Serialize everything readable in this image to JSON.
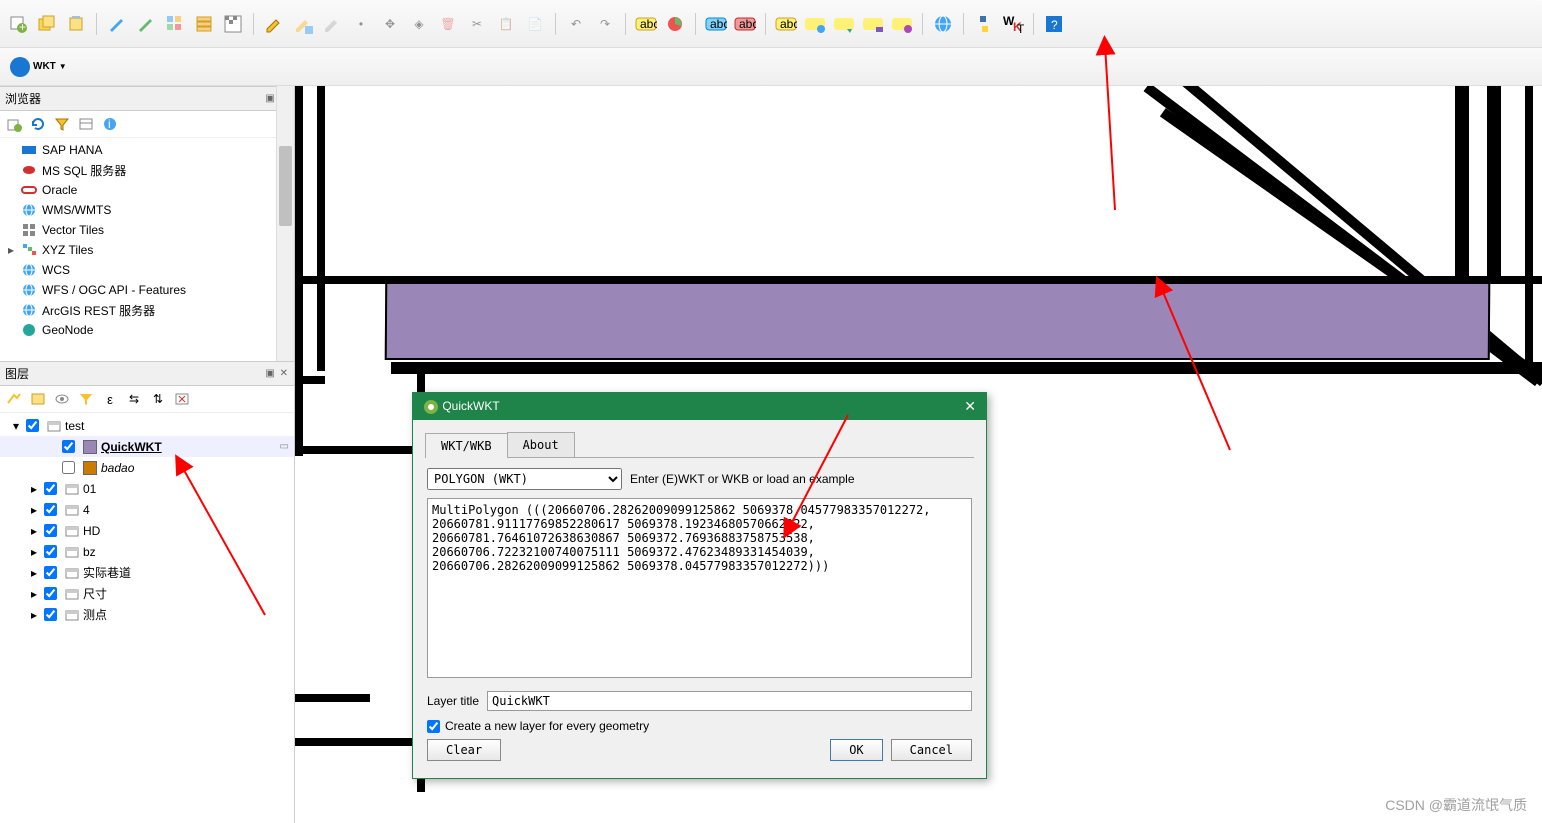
{
  "toolbar2": {
    "wkt_label": "WKT"
  },
  "browser": {
    "title": "浏览器",
    "items": [
      {
        "label": "SAP HANA",
        "icon": "sap"
      },
      {
        "label": "MS SQL 服务器",
        "icon": "mssql"
      },
      {
        "label": "Oracle",
        "icon": "oracle"
      },
      {
        "label": "WMS/WMTS",
        "icon": "globe"
      },
      {
        "label": "Vector Tiles",
        "icon": "grid"
      },
      {
        "label": "XYZ Tiles",
        "icon": "xyz",
        "expandable": true
      },
      {
        "label": "WCS",
        "icon": "globe"
      },
      {
        "label": "WFS / OGC API - Features",
        "icon": "globe"
      },
      {
        "label": "ArcGIS REST 服务器",
        "icon": "globe"
      },
      {
        "label": "GeoNode",
        "icon": "geonode"
      }
    ]
  },
  "layers": {
    "title": "图层",
    "tree": {
      "root": {
        "label": "test",
        "checked": true
      },
      "items": [
        {
          "label": "QuickWKT",
          "checked": true,
          "bold": true,
          "sym": "#9b87b7",
          "selected": true
        },
        {
          "label": "badao",
          "checked": false,
          "italic": true,
          "sym": "#cc7a00"
        },
        {
          "label": "01",
          "checked": true,
          "expandable": true
        },
        {
          "label": "4",
          "checked": true,
          "expandable": true
        },
        {
          "label": "HD",
          "checked": true,
          "expandable": true
        },
        {
          "label": "bz",
          "checked": true,
          "expandable": true
        },
        {
          "label": "实际巷道",
          "checked": true,
          "expandable": true
        },
        {
          "label": "尺寸",
          "checked": true,
          "expandable": true
        },
        {
          "label": "测点",
          "checked": true,
          "expandable": true
        }
      ]
    }
  },
  "dialog": {
    "title": "QuickWKT",
    "tabs": [
      "WKT/WKB",
      "About"
    ],
    "active_tab": 0,
    "type_label": "POLYGON (WKT)",
    "hint": "Enter (E)WKT or WKB or load an example",
    "wkt_text": "MultiPolygon (((20660706.28262009099125862 5069378.04577983357012272, 20660781.91117769852280617 5069378.19234680570662022, 20660781.76461072638630867 5069372.76936883758753538, 20660706.72232100740075111 5069372.47623489331454039, 20660706.28262009099125862 5069378.04577983357012272)))",
    "layer_title_label": "Layer title",
    "layer_title_value": "QuickWKT",
    "checkbox_label": "Create a new layer for every geometry",
    "checkbox_checked": true,
    "btn_clear": "Clear",
    "btn_ok": "OK",
    "btn_cancel": "Cancel"
  },
  "watermark": "CSDN @霸道流氓气质"
}
